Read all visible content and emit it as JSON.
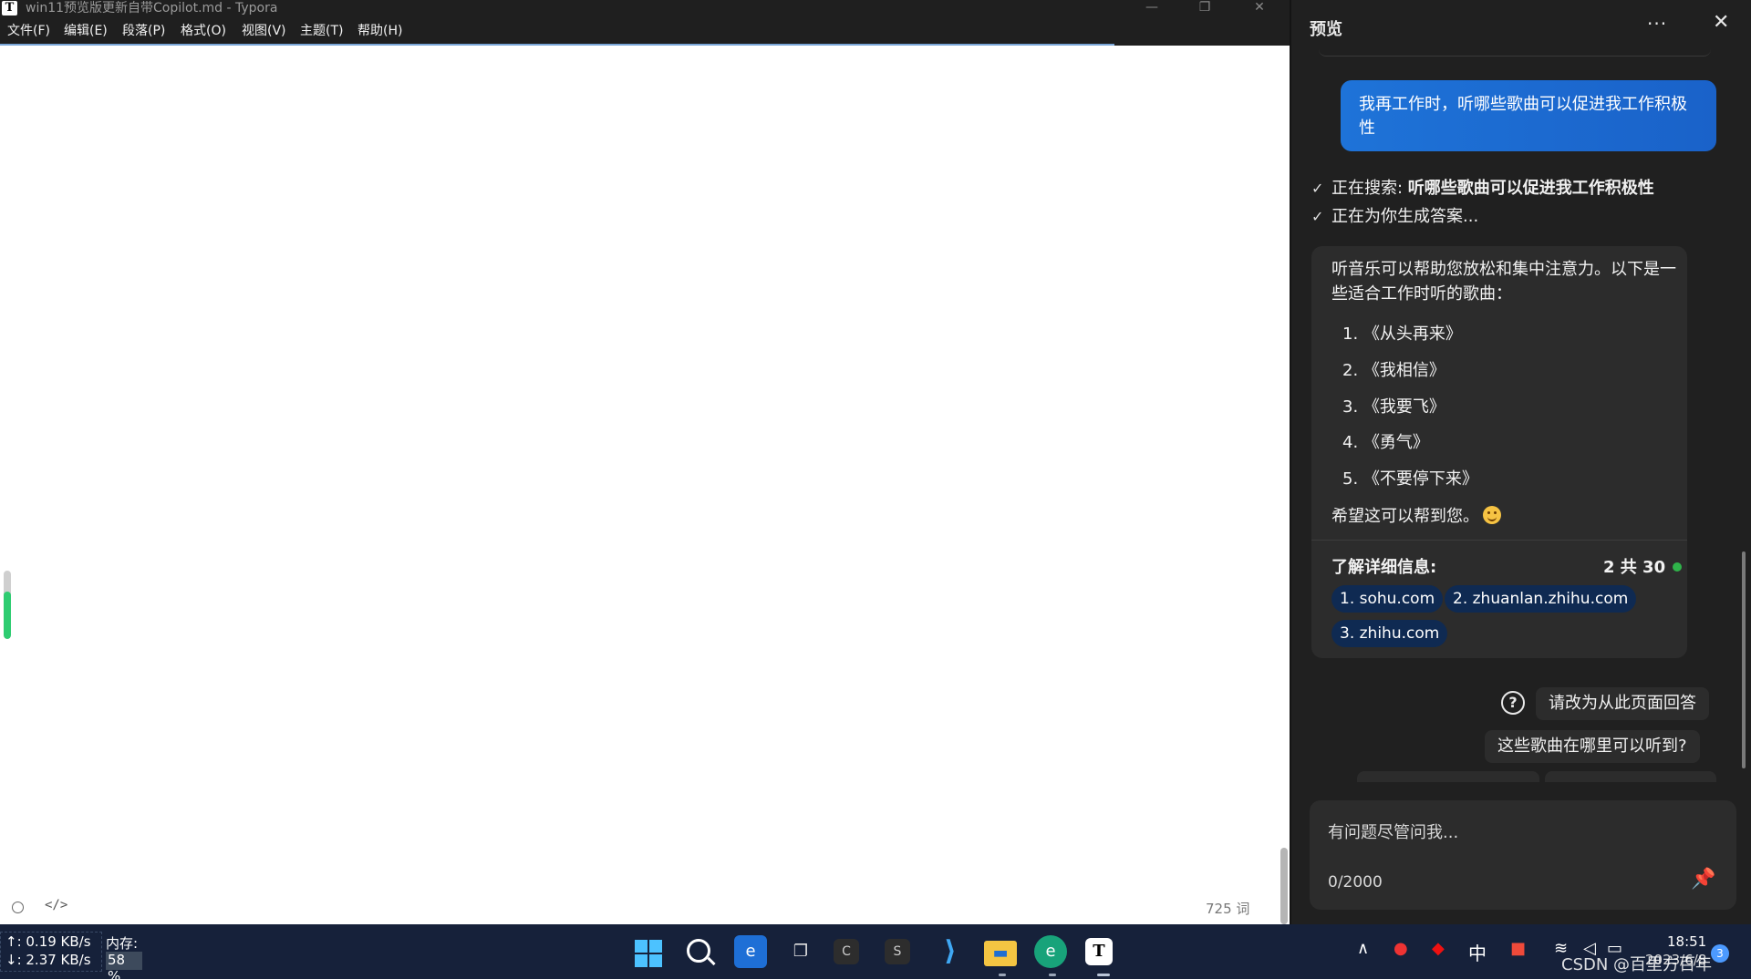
{
  "window": {
    "app_icon_glyph": "T",
    "title": "win11预览版更新自带Copilot.md - Typora",
    "controls": {
      "minimize": "—",
      "restore": "❐",
      "close": "✕"
    }
  },
  "menu": [
    {
      "id": "file",
      "label": "文件(F)"
    },
    {
      "id": "edit",
      "label": "编辑(E)"
    },
    {
      "id": "paragraph",
      "label": "段落(P)"
    },
    {
      "id": "format",
      "label": "格式(O)"
    },
    {
      "id": "view",
      "label": "视图(V)"
    },
    {
      "id": "theme",
      "label": "主题(T)"
    },
    {
      "id": "help",
      "label": "帮助(H)"
    }
  ],
  "editor": {
    "meter_fill_fraction": 0.7,
    "meter_color": "#2ecc71",
    "word_count": "725 词"
  },
  "copilot": {
    "title": "预览",
    "more_glyph": "···",
    "close_glyph": "✕",
    "user_message": "我再工作时，听哪些歌曲可以促进我工作积极性",
    "status": {
      "searching_label": "正在搜索: ",
      "searching_query": "听哪些歌曲可以促进我工作积极性",
      "generating": "正在为你生成答案..."
    },
    "answer": {
      "intro": "听音乐可以帮助您放松和集中注意力。以下是一些适合工作时听的歌曲：",
      "songs": [
        "1. 《从头再来》",
        "2. 《我相信》",
        "3. 《我要飞》",
        "4. 《勇气》",
        "5. 《不要停下来》"
      ],
      "outro": "希望这可以帮到您。"
    },
    "learn_more": {
      "label": "了解详细信息:",
      "count": "2 共 30",
      "sources": [
        "1. sohu.com",
        "2. zhuanlan.zhihu.com",
        "3. zhihu.com"
      ]
    },
    "suggestions": [
      "请改为从此页面回答",
      "这些歌曲在哪里可以听到?"
    ],
    "help_glyph": "?",
    "input": {
      "placeholder": "有问题尽管问我...",
      "char_count": "0/2000"
    },
    "accent_color": "#1e73d8"
  },
  "taskbar": {
    "net_up": "↑: 0.19 KB/s",
    "net_down": "↓: 2.37 KB/s",
    "mem_label": "内存:",
    "mem_value": "58 %",
    "apps": [
      {
        "id": "edge-preview",
        "icon": "edge-preview-icon",
        "glyph": "e"
      },
      {
        "id": "task-view",
        "icon": "task-view-icon",
        "glyph": "❐"
      },
      {
        "id": "app-c",
        "icon": "app-c-icon",
        "glyph": "C"
      },
      {
        "id": "app-s",
        "icon": "app-s-icon",
        "glyph": "S"
      },
      {
        "id": "vscode",
        "icon": "vscode-icon",
        "glyph": "⟩"
      },
      {
        "id": "explorer",
        "icon": "folder-icon",
        "glyph": "▬"
      },
      {
        "id": "edge-dev",
        "icon": "edge-dev-icon",
        "glyph": "e"
      },
      {
        "id": "typora",
        "icon": "typora-icon",
        "glyph": "T"
      }
    ],
    "tray_chevron": "∧",
    "ime": "中",
    "clock_time": "18:51",
    "clock_date": "2023/6/8",
    "notification_count": "3",
    "watermark": "CSDN @百里方百年"
  }
}
